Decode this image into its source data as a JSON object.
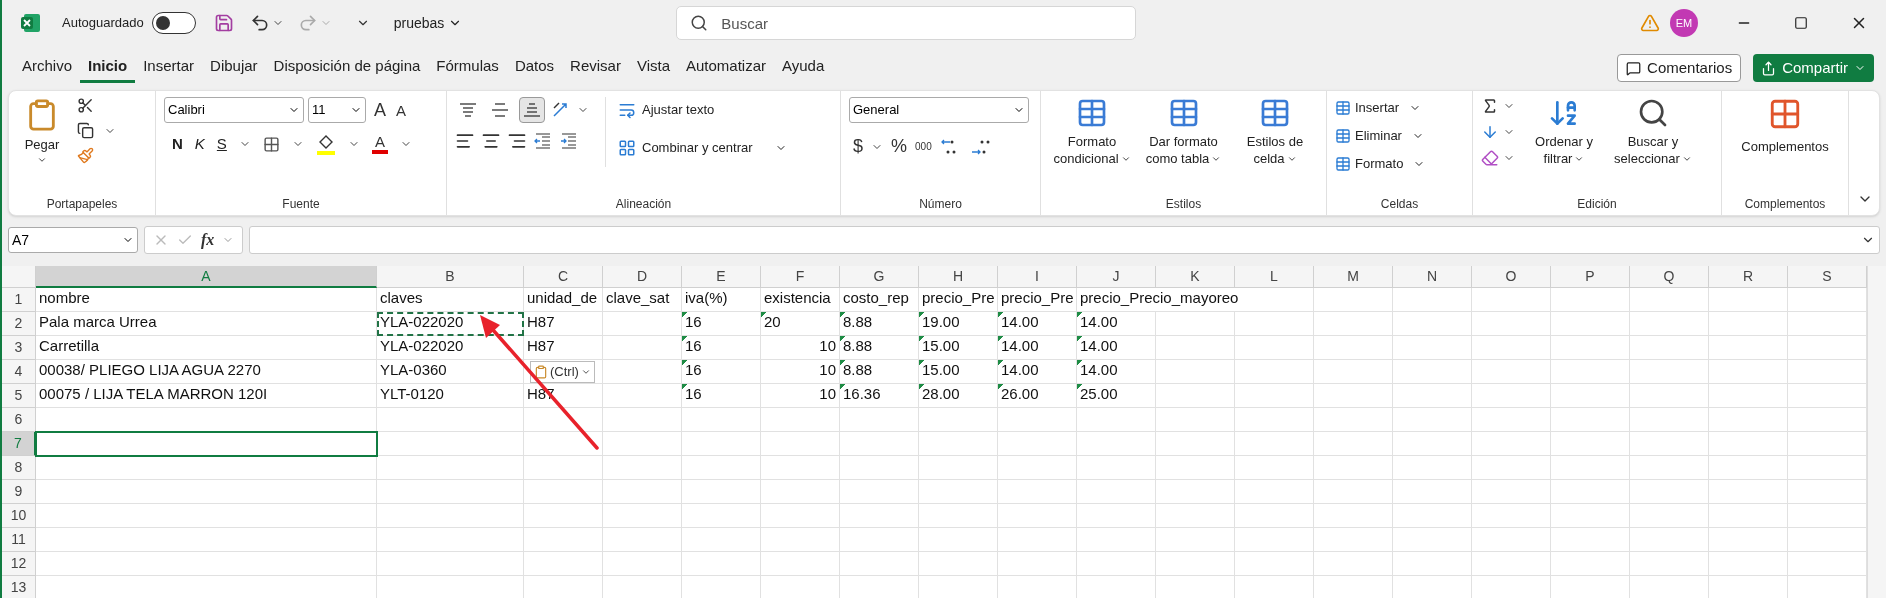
{
  "title_bar": {
    "autosave_label": "Autoguardado",
    "autosave_on": false,
    "file_name": "pruebas",
    "search_placeholder": "Buscar",
    "avatar_initials": "EM"
  },
  "menu_tabs": [
    {
      "label": "Archivo",
      "selected": false
    },
    {
      "label": "Inicio",
      "selected": true
    },
    {
      "label": "Insertar",
      "selected": false
    },
    {
      "label": "Dibujar",
      "selected": false
    },
    {
      "label": "Disposición de página",
      "selected": false
    },
    {
      "label": "Fórmulas",
      "selected": false
    },
    {
      "label": "Datos",
      "selected": false
    },
    {
      "label": "Revisar",
      "selected": false
    },
    {
      "label": "Vista",
      "selected": false
    },
    {
      "label": "Automatizar",
      "selected": false
    },
    {
      "label": "Ayuda",
      "selected": false
    }
  ],
  "comments_button": "Comentarios",
  "share_button": "Compartir",
  "ribbon": {
    "clipboard": {
      "label": "Portapapeles",
      "paste": "Pegar"
    },
    "font": {
      "label": "Fuente",
      "font_name": "Calibri",
      "font_size": "11",
      "grow": "A",
      "shrink": "A",
      "bold": "N",
      "italic": "K",
      "underline": "S",
      "font_color": "A"
    },
    "alignment": {
      "label": "Alineación",
      "vertical_align": [
        {
          "selected": false
        },
        {
          "selected": false
        },
        {
          "selected": true
        }
      ],
      "wrap_text": "Ajustar texto",
      "merge": "Combinar y centrar"
    },
    "number": {
      "label": "Número",
      "format": "General",
      "currency": "$",
      "percent": "%",
      "thousands": "000"
    },
    "styles": {
      "label": "Estilos",
      "buttons": [
        [
          "Formato",
          "condicional"
        ],
        [
          "Dar formato",
          "como tabla"
        ],
        [
          "Estilos de",
          "celda"
        ]
      ]
    },
    "cells": {
      "label": "Celdas",
      "buttons": [
        "Insertar",
        "Eliminar",
        "Formato"
      ]
    },
    "editing": {
      "label": "Edición",
      "buttons": [
        [
          "Ordenar y",
          "filtrar"
        ],
        [
          "Buscar y",
          "seleccionar"
        ]
      ]
    },
    "addins": {
      "label": "Complementos",
      "button": "Complementos"
    }
  },
  "formula_bar": {
    "name_box": "A7",
    "fx": "fx"
  },
  "sheet": {
    "columns": [
      {
        "label": "A",
        "selected": true
      },
      {
        "label": "B",
        "selected": false
      },
      {
        "label": "C",
        "selected": false
      },
      {
        "label": "D",
        "selected": false
      },
      {
        "label": "E",
        "selected": false
      },
      {
        "label": "F",
        "selected": false
      },
      {
        "label": "G",
        "selected": false
      },
      {
        "label": "H",
        "selected": false
      },
      {
        "label": "I",
        "selected": false
      },
      {
        "label": "J",
        "selected": false
      },
      {
        "label": "K",
        "selected": false
      },
      {
        "label": "L",
        "selected": false
      },
      {
        "label": "M",
        "selected": false
      },
      {
        "label": "N",
        "selected": false
      },
      {
        "label": "O",
        "selected": false
      },
      {
        "label": "P",
        "selected": false
      },
      {
        "label": "Q",
        "selected": false
      },
      {
        "label": "R",
        "selected": false
      },
      {
        "label": "S",
        "selected": false
      }
    ],
    "rows": [
      {
        "label": "1",
        "selected": false,
        "cells": [
          {
            "text": "nombre",
            "flag": false,
            "numeric": false,
            "copied": false
          },
          {
            "text": "claves",
            "flag": false,
            "numeric": false,
            "copied": false
          },
          {
            "text": "unidad_de",
            "flag": false,
            "numeric": false,
            "copied": false
          },
          {
            "text": "clave_sat",
            "flag": false,
            "numeric": false,
            "copied": false
          },
          {
            "text": "iva(%)",
            "flag": false,
            "numeric": false,
            "copied": false
          },
          {
            "text": "existencia",
            "flag": false,
            "numeric": false,
            "copied": false
          },
          {
            "text": "costo_rep",
            "flag": false,
            "numeric": false,
            "copied": false
          },
          {
            "text": "precio_Pre",
            "flag": false,
            "numeric": false,
            "copied": false
          },
          {
            "text": "precio_Pre",
            "flag": false,
            "numeric": false,
            "copied": false
          },
          {
            "text": "precio_Precio_mayoreo",
            "flag": false,
            "numeric": false,
            "copied": false
          }
        ]
      },
      {
        "label": "2",
        "selected": false,
        "cells": [
          {
            "text": "Pala marca Urrea",
            "flag": false,
            "numeric": false,
            "copied": false
          },
          {
            "text": "YLA-022020",
            "flag": false,
            "numeric": false,
            "copied": true
          },
          {
            "text": "H87",
            "flag": false,
            "numeric": false,
            "copied": false
          },
          null,
          {
            "text": "16",
            "flag": true,
            "numeric": false,
            "copied": false
          },
          {
            "text": "20",
            "flag": true,
            "numeric": false,
            "copied": false
          },
          {
            "text": "8.88",
            "flag": true,
            "numeric": false,
            "copied": false
          },
          {
            "text": "19.00",
            "flag": true,
            "numeric": false,
            "copied": false
          },
          {
            "text": "14.00",
            "flag": true,
            "numeric": false,
            "copied": false
          },
          {
            "text": "14.00",
            "flag": true,
            "numeric": false,
            "copied": false
          }
        ]
      },
      {
        "label": "3",
        "selected": false,
        "cells": [
          {
            "text": "Carretilla",
            "flag": false,
            "numeric": false,
            "copied": false
          },
          {
            "text": "YLA-022020",
            "flag": false,
            "numeric": false,
            "copied": false
          },
          {
            "text": "H87",
            "flag": false,
            "numeric": false,
            "copied": false
          },
          null,
          {
            "text": "16",
            "flag": true,
            "numeric": false,
            "copied": false
          },
          {
            "text": "10",
            "flag": false,
            "numeric": true,
            "copied": false
          },
          {
            "text": "8.88",
            "flag": true,
            "numeric": false,
            "copied": false
          },
          {
            "text": "15.00",
            "flag": true,
            "numeric": false,
            "copied": false
          },
          {
            "text": "14.00",
            "flag": true,
            "numeric": false,
            "copied": false
          },
          {
            "text": "14.00",
            "flag": true,
            "numeric": false,
            "copied": false
          }
        ]
      },
      {
        "label": "4",
        "selected": false,
        "cells": [
          {
            "text": "00038/  PLIEGO LIJA AGUA 2270",
            "flag": false,
            "numeric": false,
            "copied": false
          },
          {
            "text": "YLA-0360",
            "flag": false,
            "numeric": false,
            "copied": false
          },
          null,
          null,
          {
            "text": "16",
            "flag": true,
            "numeric": false,
            "copied": false
          },
          {
            "text": "10",
            "flag": false,
            "numeric": true,
            "copied": false
          },
          {
            "text": "8.88",
            "flag": true,
            "numeric": false,
            "copied": false
          },
          {
            "text": "15.00",
            "flag": true,
            "numeric": false,
            "copied": false
          },
          {
            "text": "14.00",
            "flag": true,
            "numeric": false,
            "copied": false
          },
          {
            "text": "14.00",
            "flag": true,
            "numeric": false,
            "copied": false
          }
        ]
      },
      {
        "label": "5",
        "selected": false,
        "cells": [
          {
            "text": "00075 / LIJA TELA MARRON 120I",
            "flag": false,
            "numeric": false,
            "copied": false
          },
          {
            "text": "YLT-0120",
            "flag": false,
            "numeric": false,
            "copied": false
          },
          {
            "text": "H87",
            "flag": false,
            "numeric": false,
            "copied": false
          },
          null,
          {
            "text": "16",
            "flag": true,
            "numeric": false,
            "copied": false
          },
          {
            "text": "10",
            "flag": false,
            "numeric": true,
            "copied": false
          },
          {
            "text": "16.36",
            "flag": true,
            "numeric": false,
            "copied": false
          },
          {
            "text": "28.00",
            "flag": true,
            "numeric": false,
            "copied": false
          },
          {
            "text": "26.00",
            "flag": true,
            "numeric": false,
            "copied": false
          },
          {
            "text": "25.00",
            "flag": true,
            "numeric": false,
            "copied": false
          }
        ]
      },
      {
        "label": "6",
        "selected": false
      },
      {
        "label": "7",
        "selected": true
      },
      {
        "label": "8",
        "selected": false
      },
      {
        "label": "9",
        "selected": false
      },
      {
        "label": "10",
        "selected": false
      },
      {
        "label": "11",
        "selected": false
      },
      {
        "label": "12",
        "selected": false
      },
      {
        "label": "13",
        "selected": false
      }
    ]
  },
  "paste_options": "(Ctrl)"
}
